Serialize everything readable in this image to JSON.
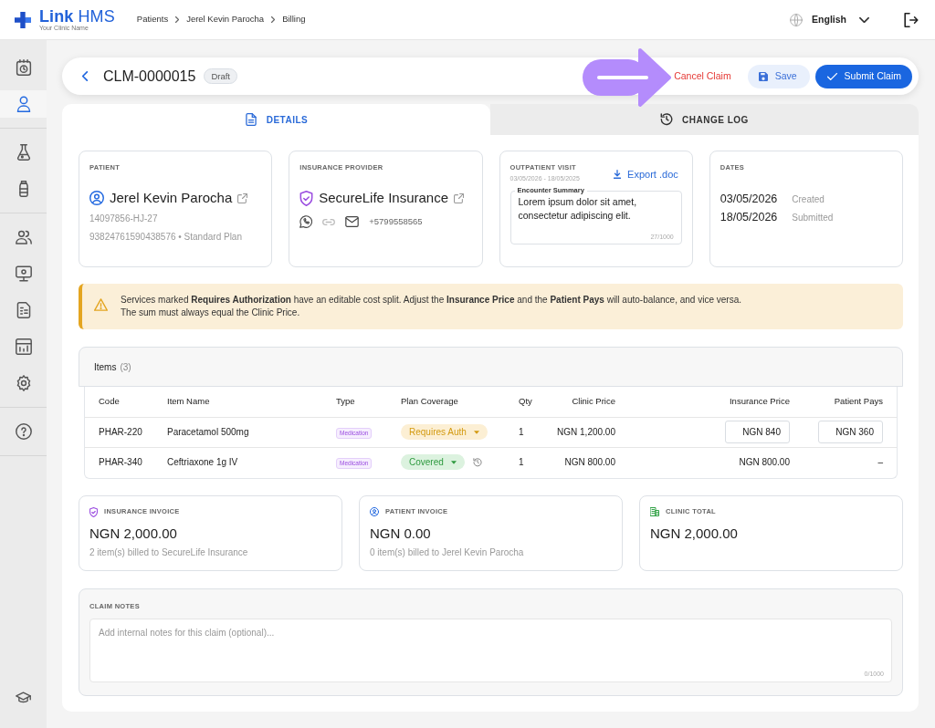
{
  "top_bar": {
    "brand": "**Link** HMS",
    "clinic_name": "Your Clinic Name",
    "breadcrumbs": [
      "Patients",
      "Jerel Kevin Parocha",
      "Billing"
    ],
    "language": "English"
  },
  "sidebar": {
    "groups": [
      [
        {
          "selected": false
        },
        {
          "selected": true
        }
      ],
      [
        {
          "selected": false
        },
        {
          "selected": false
        }
      ],
      [
        {
          "selected": false
        },
        {
          "selected": false
        },
        {
          "selected": false
        },
        {
          "selected": false
        },
        {
          "selected": false
        }
      ],
      [
        {
          "selected": false
        }
      ]
    ],
    "footer": [
      {
        "selected": false
      }
    ]
  },
  "claim_header": {
    "title": "CLM-0000015",
    "status": "Draft",
    "actions": [
      {
        "kind": "danger-link",
        "label": "Cancel Claim"
      },
      {
        "kind": "secondary",
        "label": "Save"
      },
      {
        "kind": "primary",
        "label": "Submit Claim"
      }
    ]
  },
  "tabs": [
    {
      "label": "DETAILS",
      "selected": true
    },
    {
      "label": "CHANGE LOG",
      "selected": false
    }
  ],
  "patient": {
    "heading": "PATIENT",
    "name": "Jerel Kevin Parocha",
    "patient_id": "14097856-HJ-27",
    "policy": "93824761590438576 • Standard Plan"
  },
  "insurance_provider": {
    "heading": "INSURANCE PROVIDER",
    "name": "SecureLife Insurance",
    "phone": "+5799558565"
  },
  "visit": {
    "heading": "OUTPATIENT VISIT",
    "period": "03/05/2026 - 18/05/2025",
    "export": "Export .doc",
    "summary": {
      "label": "Encounter Summary",
      "value": "Lorem ipsum dolor sit amet, consectetur adipiscing elit.",
      "counter": "27/1000"
    }
  },
  "dates": {
    "heading": "DATES",
    "rows": [
      {
        "date": "03/05/2026",
        "label": "Created"
      },
      {
        "date": "18/05/2026",
        "label": "Submitted"
      }
    ]
  },
  "alert": {
    "lines": [
      "Services marked **Requires Authorization** have an editable cost split. Adjust the **Insurance Price** and the **Patient Pays** will auto-balance, and vice versa.",
      "The sum must always equal the Clinic Price."
    ]
  },
  "items": {
    "title": "Items",
    "count": "(3)",
    "columns": [
      "Code",
      "Item Name",
      "Type",
      "Plan Coverage",
      "Qty",
      "Clinic Price",
      "Insurance Price",
      "Patient Pays"
    ],
    "rows": [
      {
        "code": "PHAR-220",
        "name": "Paracetamol 500mg",
        "type": "Medication",
        "coverage": {
          "kind": "auth",
          "label": "Requires Auth"
        },
        "history": false,
        "qty": "1",
        "clinic_price": "NGN 1,200.00",
        "insurance_price": {
          "kind": "input",
          "value": "NGN 840"
        },
        "patient_pays": {
          "kind": "input",
          "value": "NGN 360"
        }
      },
      {
        "code": "PHAR-340",
        "name": "Ceftriaxone 1g IV",
        "type": "Medication",
        "coverage": {
          "kind": "covered",
          "label": "Covered"
        },
        "history": true,
        "qty": "1",
        "clinic_price": "NGN 800.00",
        "insurance_price": {
          "kind": "text",
          "value": "NGN 800.00"
        },
        "patient_pays": {
          "kind": "text",
          "value": "–"
        }
      }
    ]
  },
  "invoices": [
    {
      "kind": "insurance",
      "heading": "INSURANCE INVOICE",
      "amount": "NGN 2,000.00",
      "note": "2 item(s) billed to SecureLife Insurance"
    },
    {
      "kind": "patient",
      "heading": "PATIENT INVOICE",
      "amount": "NGN 0.00",
      "note": "0 item(s) billed to Jerel Kevin Parocha"
    },
    {
      "kind": "clinic",
      "heading": "CLINIC TOTAL",
      "amount": "NGN 2,000.00"
    }
  ],
  "claim_notes": {
    "heading": "CLAIM NOTES",
    "placeholder": "Add internal notes for this claim (optional)...",
    "counter": "0/1000"
  }
}
